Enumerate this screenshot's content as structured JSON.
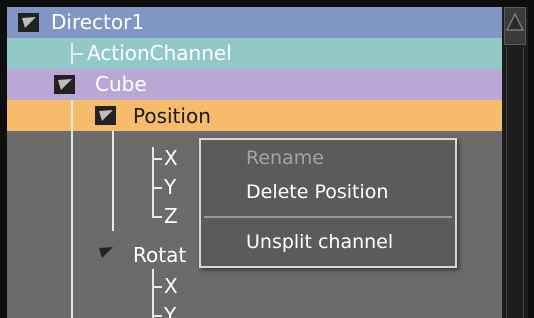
{
  "tree": {
    "director": {
      "label": "Director1",
      "color": "#8096c4"
    },
    "action_channel": {
      "label": "ActionChannel",
      "color": "#93c8c9"
    },
    "cube": {
      "label": "Cube",
      "color": "#b9a7d6"
    },
    "position": {
      "label": "Position",
      "color": "#f7bb6c",
      "children": [
        "X",
        "Y",
        "Z"
      ]
    },
    "rotation": {
      "label": "Rotat",
      "children": [
        "X",
        "Y"
      ]
    }
  },
  "context_menu": {
    "items": [
      {
        "label": "Rename",
        "enabled": false
      },
      {
        "label": "Delete Position",
        "enabled": true
      },
      {
        "label": "Unsplit channel",
        "enabled": true
      }
    ]
  },
  "icons": {
    "expander": "triangle-down-icon",
    "scroll_up": "arrow-up-icon"
  }
}
